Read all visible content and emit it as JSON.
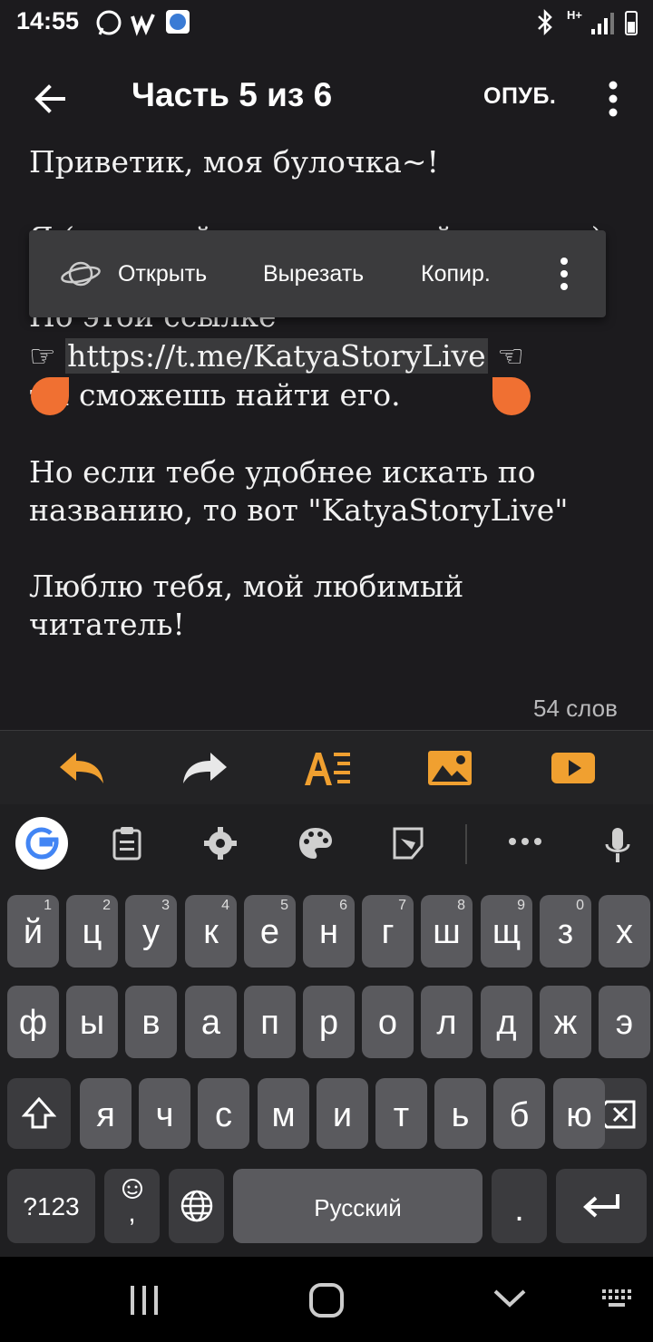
{
  "status_bar": {
    "time": "14:55",
    "network_label": "H+"
  },
  "app_bar": {
    "title": "Часть 5 из 6",
    "publish_label": "ОПУБ."
  },
  "editor": {
    "lines": [
      "Приветик, моя булочка~!",
      "Я (скрытый напечатанный человек)",
      "По этой ссылке",
      "",
      "ты сможешь найти его.",
      "Но если тебе удобнее искать по",
      "названию, то вот \"KatyaStoryLive\"",
      "Люблю тебя, мой любимый",
      "читатель!"
    ],
    "link_prefix": "☞",
    "link_text": "https://t.me/KatyaStoryLive",
    "link_suffix": "☜",
    "word_count": "54 слов"
  },
  "context_menu": {
    "open": "Открыть",
    "cut": "Вырезать",
    "copy": "Копир."
  },
  "keyboard": {
    "row1": [
      [
        "й",
        "1"
      ],
      [
        "ц",
        "2"
      ],
      [
        "у",
        "3"
      ],
      [
        "к",
        "4"
      ],
      [
        "е",
        "5"
      ],
      [
        "н",
        "6"
      ],
      [
        "г",
        "7"
      ],
      [
        "ш",
        "8"
      ],
      [
        "щ",
        "9"
      ],
      [
        "з",
        "0"
      ],
      [
        "х",
        ""
      ]
    ],
    "row2": [
      "ф",
      "ы",
      "в",
      "а",
      "п",
      "р",
      "о",
      "л",
      "д",
      "ж",
      "э"
    ],
    "row3": [
      "я",
      "ч",
      "с",
      "м",
      "и",
      "т",
      "ь",
      "б",
      "ю"
    ],
    "symbols_label": "?123",
    "space_label": "Русский",
    "period_label": ".",
    "comma_label": ","
  },
  "colors": {
    "accent": "#f07032",
    "background": "#1c1b1e",
    "key": "#5a5a5e"
  },
  "icons": [
    "whatsapp-icon",
    "wattpad-icon",
    "app-icon",
    "bluetooth-icon",
    "signal-icon",
    "battery-icon",
    "back-arrow-icon",
    "more-vert-icon",
    "browser-icon",
    "undo-icon",
    "redo-icon",
    "text-format-icon",
    "image-icon",
    "video-icon",
    "google-icon",
    "clipboard-icon",
    "settings-icon",
    "palette-icon",
    "stickers-icon",
    "more-icon",
    "mic-icon",
    "shift-icon",
    "backspace-icon",
    "emoji-icon",
    "globe-icon",
    "enter-icon",
    "recents-icon",
    "home-icon",
    "back-icon",
    "keyboard-icon"
  ]
}
